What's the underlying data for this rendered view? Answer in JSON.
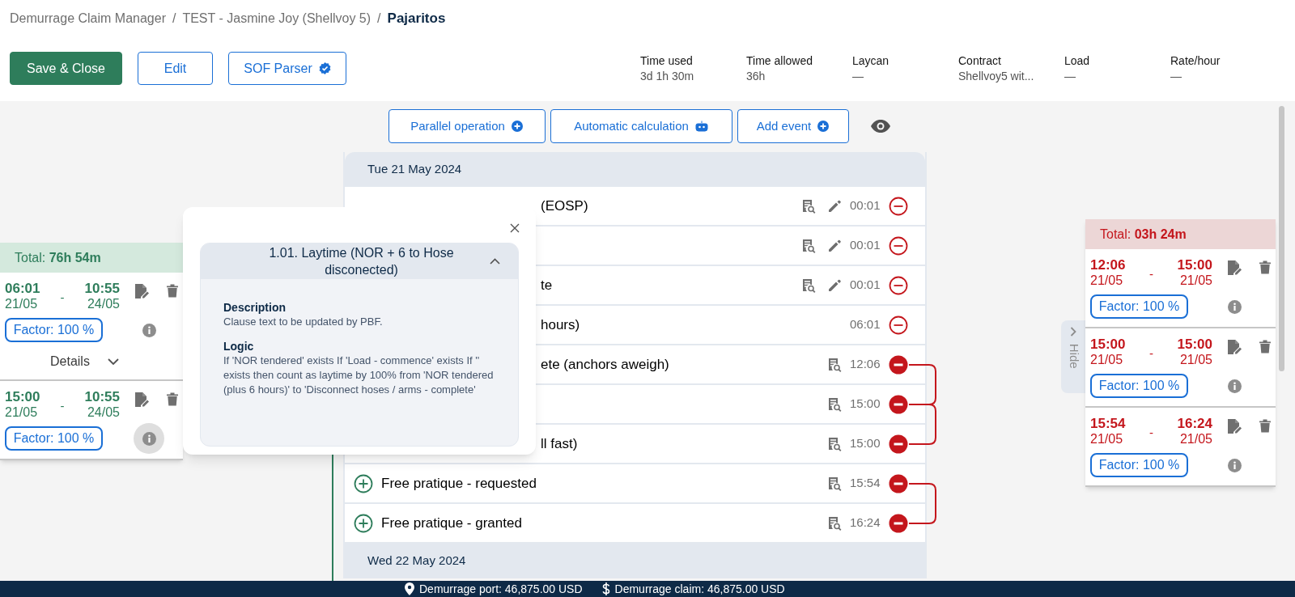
{
  "breadcrumb": [
    {
      "label": "Demurrage Claim Manager",
      "kind": "link"
    },
    {
      "label": "/",
      "kind": "separator"
    },
    {
      "label": "TEST - Jasmine Joy (Shellvoy 5)",
      "kind": "link"
    },
    {
      "label": "/",
      "kind": "separator"
    },
    {
      "label": "Pajaritos",
      "kind": "current"
    }
  ],
  "header_buttons": [
    {
      "label": "Save & Close",
      "kind": "primary"
    },
    {
      "label": "Edit",
      "kind": "outline"
    },
    {
      "label": "SOF Parser",
      "kind": "verified"
    }
  ],
  "stats": [
    {
      "label": "Time used",
      "value": "3d 1h 30m"
    },
    {
      "label": "Time allowed",
      "value": "36h"
    },
    {
      "label": "Laycan",
      "value": "—"
    },
    {
      "label": "Contract",
      "value": "Shellvoy5 wit..."
    },
    {
      "label": "Load",
      "value": "—"
    },
    {
      "label": "Rate/hour",
      "value": "—"
    }
  ],
  "toolbar": [
    {
      "label": "Parallel operation",
      "kind": "add"
    },
    {
      "label": "Automatic calculation",
      "kind": "auto"
    },
    {
      "label": "Add event",
      "kind": "add"
    }
  ],
  "days": [
    {
      "date": "Tue 21 May 2024",
      "events": [
        {
          "name": "(EOSP)",
          "kind": "partial",
          "time": "00:01",
          "document": true,
          "editable": true,
          "linked": false,
          "linked_to_next": false
        },
        {
          "kind": "hidden",
          "time": "00:01",
          "document": true,
          "editable": true,
          "linked": false,
          "linked_to_next": false
        },
        {
          "name": "te",
          "kind": "partial",
          "time": "00:01",
          "document": true,
          "editable": true,
          "linked": false,
          "linked_to_next": false
        },
        {
          "name": "hours)",
          "kind": "partial",
          "time": "06:01",
          "document": false,
          "editable": false,
          "linked": false,
          "linked_to_next": false
        },
        {
          "name": "ete (anchors aweigh)",
          "kind": "partial",
          "time": "12:06",
          "document": true,
          "editable": false,
          "linked": true,
          "linked_to_next": true
        },
        {
          "kind": "hidden",
          "time": "15:00",
          "document": true,
          "editable": false,
          "linked": true,
          "linked_to_next": true
        },
        {
          "name": "ll fast)",
          "kind": "partial",
          "time": "15:00",
          "document": true,
          "editable": false,
          "linked": true,
          "linked_to_next": false
        },
        {
          "name": "Free pratique - requested",
          "kind": "full",
          "time": "15:54",
          "document": true,
          "editable": false,
          "linked": true,
          "linked_to_next": true
        },
        {
          "name": "Free pratique - granted",
          "kind": "full",
          "time": "16:24",
          "document": true,
          "editable": false,
          "linked": true,
          "linked_to_next": false
        }
      ]
    },
    {
      "date": "Wed 22 May 2024"
    }
  ],
  "left_panel": {
    "total": "Total: **76h 54m**",
    "periods": [
      {
        "start_time": "06:01",
        "start_date": "21/05",
        "separator": "-",
        "end_time": "10:55",
        "end_date": "24/05",
        "factor": "Factor: 100 %",
        "info_active": false,
        "details": "Details"
      },
      {
        "start_time": "15:00",
        "start_date": "21/05",
        "separator": "-",
        "end_time": "10:55",
        "end_date": "24/05",
        "factor": "Factor: 100 %",
        "info_active": true
      }
    ]
  },
  "popup": {
    "title": "1.01. Laytime (NOR + 6 to Hose disconected)",
    "expanded": true,
    "sections": [
      {
        "heading": "Description",
        "text": "Clause text to be updated by PBF."
      },
      {
        "heading": "Logic",
        "text": "If 'NOR tendered' exists If 'Load - commence' exists If '' exists then count as laytime by 100% from 'NOR tendered (plus 6 hours)' to 'Disconnect hoses / arms - complete'"
      }
    ]
  },
  "right_panel": {
    "total": "Total: **03h 24m**",
    "hide_label": "Hide",
    "periods": [
      {
        "start_time": "12:06",
        "start_date": "21/05",
        "separator": "-",
        "end_time": "15:00",
        "end_date": "21/05",
        "factor": "Factor: 100 %",
        "info_active": false
      },
      {
        "start_time": "15:00",
        "start_date": "21/05",
        "separator": "-",
        "end_time": "15:00",
        "end_date": "21/05",
        "factor": "Factor: 100 %",
        "info_active": false
      },
      {
        "start_time": "15:54",
        "start_date": "21/05",
        "separator": "-",
        "end_time": "16:24",
        "end_date": "21/05",
        "factor": "Factor: 100 %",
        "info_active": false
      }
    ]
  },
  "footer": [
    {
      "kind": "port",
      "text": "Demurrage port: 46,875.00 USD"
    },
    {
      "kind": "claim",
      "text": "Demurrage claim: 46,875.00 USD"
    }
  ]
}
